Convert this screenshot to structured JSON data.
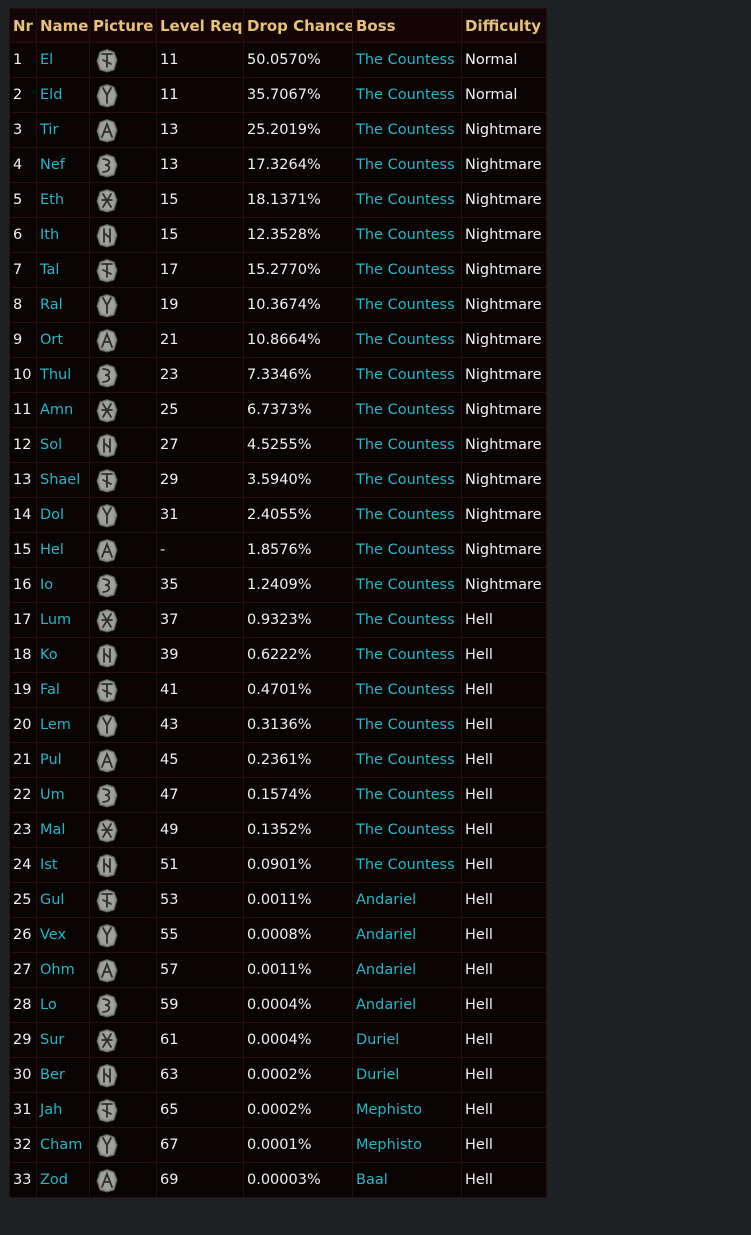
{
  "table": {
    "headers": [
      "Nr",
      "Name",
      "Picture",
      "Level Req.",
      "Drop Chance",
      "Boss",
      "Difficulty"
    ],
    "rows": [
      {
        "nr": "1",
        "name": "El",
        "icon": "el-rune-icon",
        "level": "11",
        "drop": "50.0570%",
        "boss": "The Countess",
        "difficulty": "Normal"
      },
      {
        "nr": "2",
        "name": "Eld",
        "icon": "eld-rune-icon",
        "level": "11",
        "drop": "35.7067%",
        "boss": "The Countess",
        "difficulty": "Normal"
      },
      {
        "nr": "3",
        "name": "Tir",
        "icon": "tir-rune-icon",
        "level": "13",
        "drop": "25.2019%",
        "boss": "The Countess",
        "difficulty": "Nightmare"
      },
      {
        "nr": "4",
        "name": "Nef",
        "icon": "nef-rune-icon",
        "level": "13",
        "drop": "17.3264%",
        "boss": "The Countess",
        "difficulty": "Nightmare"
      },
      {
        "nr": "5",
        "name": "Eth",
        "icon": "eth-rune-icon",
        "level": "15",
        "drop": "18.1371%",
        "boss": "The Countess",
        "difficulty": "Nightmare"
      },
      {
        "nr": "6",
        "name": "Ith",
        "icon": "ith-rune-icon",
        "level": "15",
        "drop": "12.3528%",
        "boss": "The Countess",
        "difficulty": "Nightmare"
      },
      {
        "nr": "7",
        "name": "Tal",
        "icon": "tal-rune-icon",
        "level": "17",
        "drop": "15.2770%",
        "boss": "The Countess",
        "difficulty": "Nightmare"
      },
      {
        "nr": "8",
        "name": "Ral",
        "icon": "ral-rune-icon",
        "level": "19",
        "drop": "10.3674%",
        "boss": "The Countess",
        "difficulty": "Nightmare"
      },
      {
        "nr": "9",
        "name": "Ort",
        "icon": "ort-rune-icon",
        "level": "21",
        "drop": "10.8664%",
        "boss": "The Countess",
        "difficulty": "Nightmare"
      },
      {
        "nr": "10",
        "name": "Thul",
        "icon": "thul-rune-icon",
        "level": "23",
        "drop": "7.3346%",
        "boss": "The Countess",
        "difficulty": "Nightmare"
      },
      {
        "nr": "11",
        "name": "Amn",
        "icon": "amn-rune-icon",
        "level": "25",
        "drop": "6.7373%",
        "boss": "The Countess",
        "difficulty": "Nightmare"
      },
      {
        "nr": "12",
        "name": "Sol",
        "icon": "sol-rune-icon",
        "level": "27",
        "drop": "4.5255%",
        "boss": "The Countess",
        "difficulty": "Nightmare"
      },
      {
        "nr": "13",
        "name": "Shael",
        "icon": "shael-rune-icon",
        "level": "29",
        "drop": "3.5940%",
        "boss": "The Countess",
        "difficulty": "Nightmare"
      },
      {
        "nr": "14",
        "name": "Dol",
        "icon": "dol-rune-icon",
        "level": "31",
        "drop": "2.4055%",
        "boss": "The Countess",
        "difficulty": "Nightmare"
      },
      {
        "nr": "15",
        "name": "Hel",
        "icon": "hel-rune-icon",
        "level": "-",
        "drop": "1.8576%",
        "boss": "The Countess",
        "difficulty": "Nightmare"
      },
      {
        "nr": "16",
        "name": "Io",
        "icon": "io-rune-icon",
        "level": "35",
        "drop": "1.2409%",
        "boss": "The Countess",
        "difficulty": "Nightmare"
      },
      {
        "nr": "17",
        "name": "Lum",
        "icon": "lum-rune-icon",
        "level": "37",
        "drop": "0.9323%",
        "boss": "The Countess",
        "difficulty": "Hell"
      },
      {
        "nr": "18",
        "name": "Ko",
        "icon": "ko-rune-icon",
        "level": "39",
        "drop": "0.6222%",
        "boss": "The Countess",
        "difficulty": "Hell"
      },
      {
        "nr": "19",
        "name": "Fal",
        "icon": "fal-rune-icon",
        "level": "41",
        "drop": "0.4701%",
        "boss": "The Countess",
        "difficulty": "Hell"
      },
      {
        "nr": "20",
        "name": "Lem",
        "icon": "lem-rune-icon",
        "level": "43",
        "drop": "0.3136%",
        "boss": "The Countess",
        "difficulty": "Hell"
      },
      {
        "nr": "21",
        "name": "Pul",
        "icon": "pul-rune-icon",
        "level": "45",
        "drop": "0.2361%",
        "boss": "The Countess",
        "difficulty": "Hell"
      },
      {
        "nr": "22",
        "name": "Um",
        "icon": "um-rune-icon",
        "level": "47",
        "drop": "0.1574%",
        "boss": "The Countess",
        "difficulty": "Hell"
      },
      {
        "nr": "23",
        "name": "Mal",
        "icon": "mal-rune-icon",
        "level": "49",
        "drop": "0.1352%",
        "boss": "The Countess",
        "difficulty": "Hell"
      },
      {
        "nr": "24",
        "name": "Ist",
        "icon": "ist-rune-icon",
        "level": "51",
        "drop": "0.0901%",
        "boss": "The Countess",
        "difficulty": "Hell"
      },
      {
        "nr": "25",
        "name": "Gul",
        "icon": "gul-rune-icon",
        "level": "53",
        "drop": "0.0011%",
        "boss": "Andariel",
        "difficulty": "Hell"
      },
      {
        "nr": "26",
        "name": "Vex",
        "icon": "vex-rune-icon",
        "level": "55",
        "drop": "0.0008%",
        "boss": "Andariel",
        "difficulty": "Hell"
      },
      {
        "nr": "27",
        "name": "Ohm",
        "icon": "ohm-rune-icon",
        "level": "57",
        "drop": "0.0011%",
        "boss": "Andariel",
        "difficulty": "Hell"
      },
      {
        "nr": "28",
        "name": "Lo",
        "icon": "lo-rune-icon",
        "level": "59",
        "drop": "0.0004%",
        "boss": "Andariel",
        "difficulty": "Hell"
      },
      {
        "nr": "29",
        "name": "Sur",
        "icon": "sur-rune-icon",
        "level": "61",
        "drop": "0.0004%",
        "boss": "Duriel",
        "difficulty": "Hell"
      },
      {
        "nr": "30",
        "name": "Ber",
        "icon": "ber-rune-icon",
        "level": "63",
        "drop": "0.0002%",
        "boss": "Duriel",
        "difficulty": "Hell"
      },
      {
        "nr": "31",
        "name": "Jah",
        "icon": "jah-rune-icon",
        "level": "65",
        "drop": "0.0002%",
        "boss": "Mephisto",
        "difficulty": "Hell"
      },
      {
        "nr": "32",
        "name": "Cham",
        "icon": "cham-rune-icon",
        "level": "67",
        "drop": "0.0001%",
        "boss": "Mephisto",
        "difficulty": "Hell"
      },
      {
        "nr": "33",
        "name": "Zod",
        "icon": "zod-rune-icon",
        "level": "69",
        "drop": "0.00003%",
        "boss": "Baal",
        "difficulty": "Hell"
      }
    ]
  },
  "colors": {
    "header_text": "#e8c07a",
    "link": "#21b8c8",
    "table_bg": "#0a0303",
    "page_bg": "#1e2124"
  }
}
